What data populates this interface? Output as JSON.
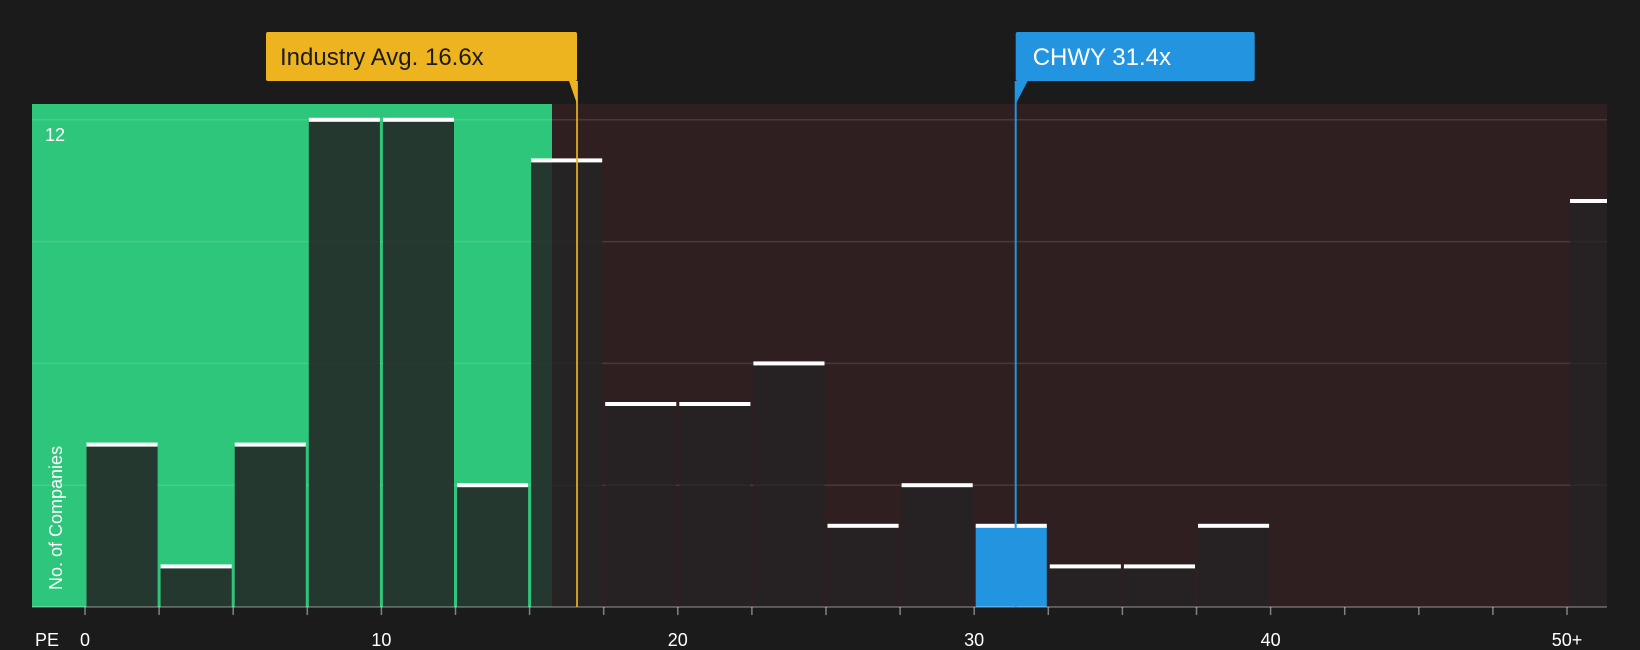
{
  "chart_data": {
    "type": "bar",
    "xlabel": "PE",
    "ylabel": "No. of Companies",
    "y_tick_labels": [
      {
        "value": 12,
        "label": "12"
      }
    ],
    "ylim": [
      0,
      12.5
    ],
    "x_ticks": [
      0,
      2.5,
      5,
      7.5,
      10,
      12.5,
      15,
      17.5,
      20,
      22.5,
      25,
      27.5,
      30,
      32.5,
      35,
      37.5,
      40,
      42.5,
      45,
      47.5,
      50
    ],
    "x_tick_labels": [
      {
        "value": 0,
        "label": "0"
      },
      {
        "value": 10,
        "label": "10"
      },
      {
        "value": 20,
        "label": "20"
      },
      {
        "value": 30,
        "label": "30"
      },
      {
        "value": 40,
        "label": "40"
      },
      {
        "value": 50,
        "label": "50+"
      }
    ],
    "bins": [
      {
        "start": 0,
        "end": 2.5,
        "count": 4
      },
      {
        "start": 2.5,
        "end": 5,
        "count": 1
      },
      {
        "start": 5,
        "end": 7.5,
        "count": 4
      },
      {
        "start": 7.5,
        "end": 10,
        "count": 12
      },
      {
        "start": 10,
        "end": 12.5,
        "count": 12
      },
      {
        "start": 12.5,
        "end": 15,
        "count": 3
      },
      {
        "start": 15,
        "end": 17.5,
        "count": 11
      },
      {
        "start": 17.5,
        "end": 20,
        "count": 5
      },
      {
        "start": 20,
        "end": 22.5,
        "count": 5
      },
      {
        "start": 22.5,
        "end": 25,
        "count": 6
      },
      {
        "start": 25,
        "end": 27.5,
        "count": 2
      },
      {
        "start": 27.5,
        "end": 30,
        "count": 3
      },
      {
        "start": 30,
        "end": 32.5,
        "count": 2,
        "highlight": true
      },
      {
        "start": 32.5,
        "end": 35,
        "count": 1
      },
      {
        "start": 35,
        "end": 37.5,
        "count": 1
      },
      {
        "start": 37.5,
        "end": 40,
        "count": 2
      },
      {
        "start": 50,
        "end": 51.3,
        "count": 10
      }
    ],
    "annotations": [
      {
        "label": "Industry Avg. 16.6x",
        "value": 16.6,
        "color": "#eeb41f"
      },
      {
        "label": "CHWY 31.4x",
        "value": 31.4,
        "color": "#2394e0"
      }
    ],
    "colors": {
      "below_region": "#2ec67b",
      "above_region": "#2f1f20",
      "bar": "#242424",
      "highlight_bar": "#2394e0",
      "bar_cap": "#ffffff"
    },
    "grid": true
  }
}
